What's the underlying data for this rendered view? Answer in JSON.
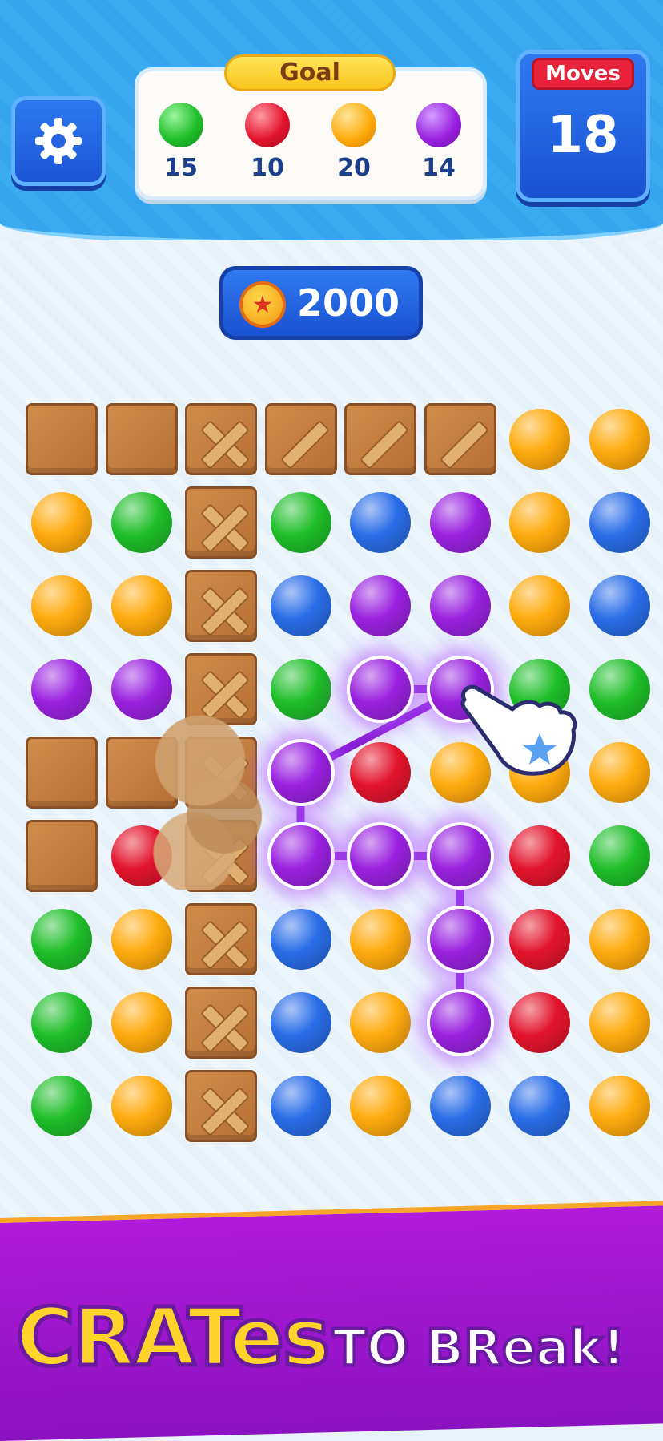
{
  "header": {
    "goal_label": "Goal",
    "goals": [
      {
        "color": "#1fbf2a",
        "count": "15"
      },
      {
        "color": "#e3142b",
        "count": "10"
      },
      {
        "color": "#ffab0d",
        "count": "20"
      },
      {
        "color": "#9a22e0",
        "count": "14"
      }
    ],
    "moves_label": "Moves",
    "moves_value": "18",
    "settings_icon": "gear-icon"
  },
  "coins": {
    "value": "2000",
    "icon": "coin-star-icon"
  },
  "board": {
    "colors": {
      "G": "#1fbf2a",
      "R": "#e3142b",
      "Y": "#ffab0d",
      "B": "#2a6de8",
      "P": "#9a22e0"
    },
    "grid": [
      [
        "C",
        "C",
        "X",
        "S",
        "S",
        "S",
        "Y",
        "Y"
      ],
      [
        "Y",
        "G",
        "X",
        "G",
        "B",
        "P",
        "Y",
        "B"
      ],
      [
        "Y",
        "Y",
        "X",
        "B",
        "P",
        "P",
        "Y",
        "B"
      ],
      [
        "P",
        "P",
        "X",
        "G",
        "P",
        "P",
        "G",
        "G"
      ],
      [
        "C",
        "C",
        "X",
        "P",
        "R",
        "Y",
        "Y",
        "Y"
      ],
      [
        "C",
        "R",
        "X",
        "P",
        "P",
        "P",
        "R",
        "G"
      ],
      [
        "G",
        "Y",
        "X",
        "B",
        "Y",
        "P",
        "R",
        "Y"
      ],
      [
        "G",
        "Y",
        "X",
        "B",
        "Y",
        "P",
        "R",
        "Y"
      ],
      [
        "G",
        "Y",
        "X",
        "B",
        "Y",
        "B",
        "B",
        "Y"
      ]
    ],
    "selected_path": [
      [
        3,
        4
      ],
      [
        3,
        5
      ],
      [
        4,
        3
      ],
      [
        5,
        3
      ],
      [
        5,
        4
      ],
      [
        5,
        5
      ],
      [
        6,
        5
      ],
      [
        7,
        5
      ]
    ]
  },
  "banner": {
    "word1": "CRATes",
    "word2": "TO BReak!"
  }
}
